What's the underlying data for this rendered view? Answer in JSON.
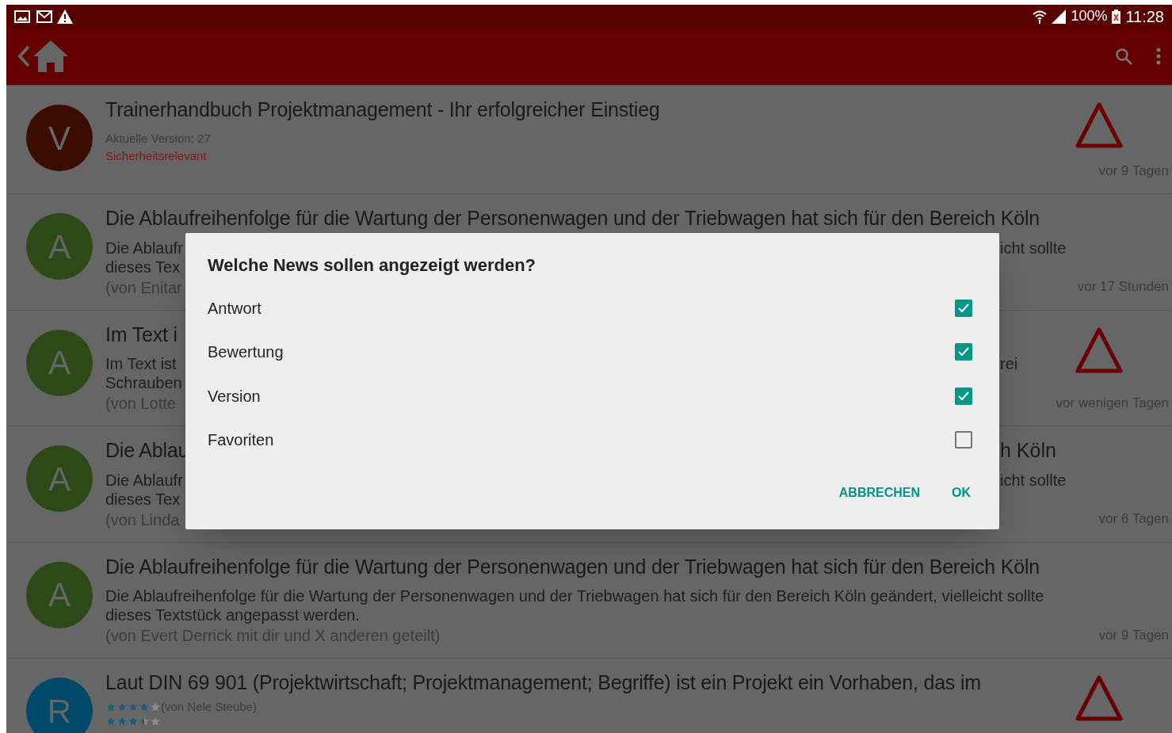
{
  "status_bar": {
    "battery": "100%",
    "time": "11:28"
  },
  "rows": [
    {
      "avatar": {
        "letter": "V",
        "color": "#3b0d00"
      },
      "title": {
        "left": "Trainerhandbuch Projektmanagement - Ihr erfolgreicher Einstieg"
      },
      "lines": [
        {
          "kind": "meta",
          "left": "Aktuelle Version: 27"
        },
        {
          "kind": "alert",
          "left": "Sicherheitsrelevant"
        }
      ],
      "warning": true,
      "time": "vor 9 Tagen"
    },
    {
      "avatar": {
        "letter": "A",
        "color": "#2c4a17"
      },
      "title": {
        "left": "Die Ablaufreihenfolge für die Wartung der Personenwagen und der Triebwagen hat sich für den Bereich Köln"
      },
      "lines": [
        {
          "kind": "body",
          "left": "Die Ablaufr",
          "right": "icht sollte"
        },
        {
          "kind": "body",
          "left": "dieses Tex"
        },
        {
          "kind": "author",
          "left": "(von Enitar"
        }
      ],
      "warning": false,
      "time": "vor 17 Stunden"
    },
    {
      "avatar": {
        "letter": "A",
        "color": "#2c4a17"
      },
      "title": {
        "left": "Im Text i"
      },
      "lines": [
        {
          "kind": "body",
          "left": "Im Text ist",
          "right": "rei"
        },
        {
          "kind": "body",
          "left": "Schrauben"
        },
        {
          "kind": "author",
          "left": "(von Lotte"
        }
      ],
      "warning": true,
      "time": "vor wenigen Tagen"
    },
    {
      "avatar": {
        "letter": "A",
        "color": "#2c4a17"
      },
      "title": {
        "left": "Die Ablau",
        "right": "h Köln"
      },
      "lines": [
        {
          "kind": "body",
          "left": "Die Ablaufr",
          "right": "icht sollte"
        },
        {
          "kind": "body",
          "left": "dieses Tex"
        },
        {
          "kind": "author",
          "left": "(von Linda"
        }
      ],
      "warning": false,
      "time": "vor 6 Tagen"
    },
    {
      "avatar": {
        "letter": "A",
        "color": "#2c4a17"
      },
      "title": {
        "left": "Die Ablaufreihenfolge für die Wartung der Personenwagen und der Triebwagen hat sich für den Bereich Köln"
      },
      "lines": [
        {
          "kind": "body",
          "left": "Die Ablaufreihenfolge für die Wartung der Personenwagen und der Triebwagen hat sich für den Bereich Köln geändert, vielleicht sollte"
        },
        {
          "kind": "body",
          "left": "dieses Textstück angepasst werden."
        },
        {
          "kind": "author",
          "left": "(von Evert Derrick mit dir und X anderen geteilt)"
        }
      ],
      "warning": false,
      "time": "vor 9 Tagen"
    },
    {
      "avatar": {
        "letter": "R",
        "color": "#004968"
      },
      "title": {
        "left": "Laut DIN 69 901 (Projektwirtschaft; Projektmanagement; Begriffe) ist ein Projekt ein Vorhaben, das im"
      },
      "lines": [
        {
          "kind": "rating",
          "stars": 4,
          "left": "(von Nele Steube)"
        },
        {
          "kind": "rating",
          "stars": 3.5
        }
      ],
      "warning": true
    }
  ],
  "dialog": {
    "title": "Welche News sollen angezeigt werden?",
    "options": [
      {
        "label": "Antwort",
        "checked": true
      },
      {
        "label": "Bewertung",
        "checked": true
      },
      {
        "label": "Version",
        "checked": true
      },
      {
        "label": "Favoriten",
        "checked": false
      }
    ],
    "buttons": [
      "ABBRECHEN",
      "OK"
    ]
  }
}
